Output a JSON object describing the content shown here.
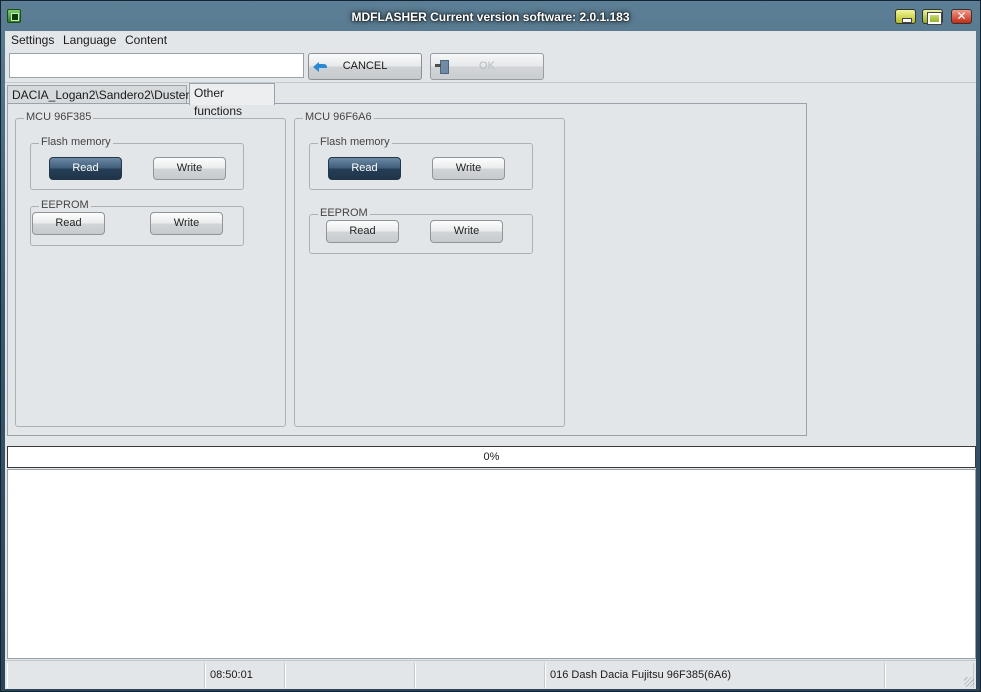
{
  "window": {
    "title": "MDFLASHER  Current version software: 2.0.1.183",
    "accent": "#3c5a70"
  },
  "menu": {
    "items": [
      "Settings",
      "Language",
      "Content"
    ]
  },
  "toolbar": {
    "input_value": "",
    "cancel_label": "CANCEL",
    "ok_label": "OK"
  },
  "tabs": [
    {
      "label": "DACIA_Logan2\\Sandero2\\Duster2",
      "active": false
    },
    {
      "label": "Other functions",
      "active": true
    }
  ],
  "mcus": [
    {
      "title": "MCU 96F385",
      "flash": {
        "title": "Flash memory",
        "read": "Read",
        "write": "Write"
      },
      "eeprom": {
        "title": "EEPROM",
        "read": "Read",
        "write": "Write"
      }
    },
    {
      "title": "MCU 96F6A6",
      "flash": {
        "title": "Flash memory",
        "read": "Read",
        "write": "Write"
      },
      "eeprom": {
        "title": "EEPROM",
        "read": "Read",
        "write": "Write"
      }
    }
  ],
  "progress": {
    "text": "0%",
    "value": 0
  },
  "log": {
    "text": ""
  },
  "status": {
    "cell1": "",
    "time": "08:50:01",
    "cell3": "",
    "cell4": "",
    "device": "016 Dash Dacia Fujitsu 96F385(6A6)",
    "cell6": ""
  }
}
